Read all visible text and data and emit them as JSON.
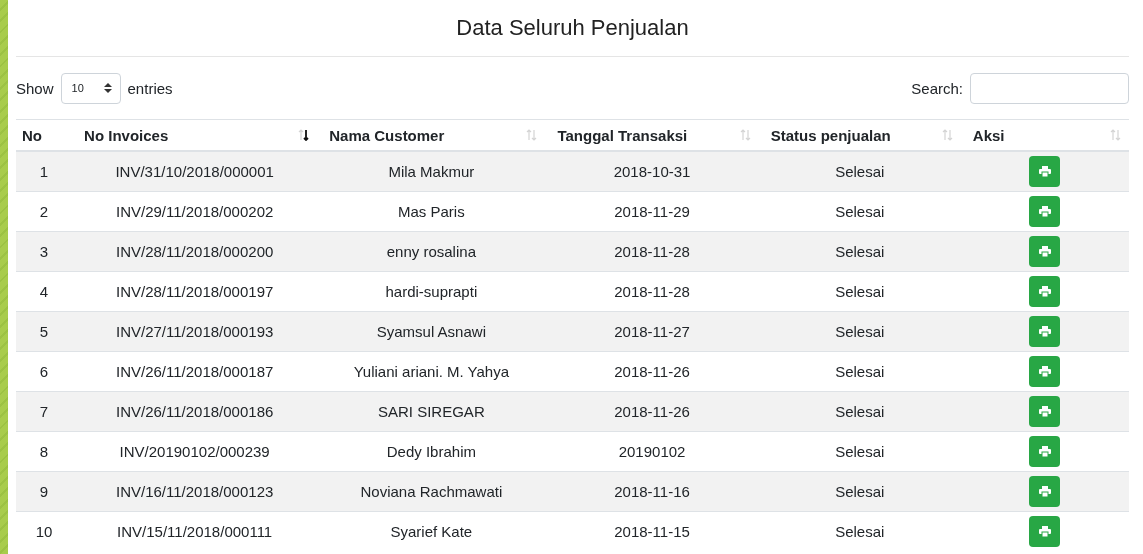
{
  "title": "Data Seluruh Penjualan",
  "length_control": {
    "label_before": "Show",
    "value": "10",
    "label_after": "entries"
  },
  "search": {
    "label": "Search:"
  },
  "table": {
    "columns": [
      {
        "label": "No",
        "sortable": false
      },
      {
        "label": "No Invoices",
        "sortable": true,
        "sorted": true
      },
      {
        "label": "Nama Customer",
        "sortable": true,
        "sorted": false
      },
      {
        "label": "Tanggal Transaksi",
        "sortable": true,
        "sorted": false
      },
      {
        "label": "Status penjualan",
        "sortable": true,
        "sorted": false
      },
      {
        "label": "Aksi",
        "sortable": true,
        "sorted": false
      }
    ],
    "rows": [
      [
        "1",
        "INV/31/10/2018/000001",
        "Mila Makmur",
        "2018-10-31",
        "Selesai"
      ],
      [
        "2",
        "INV/29/11/2018/000202",
        "Mas Paris",
        "2018-11-29",
        "Selesai"
      ],
      [
        "3",
        "INV/28/11/2018/000200",
        "enny rosalina",
        "2018-11-28",
        "Selesai"
      ],
      [
        "4",
        "INV/28/11/2018/000197",
        "hardi-suprapti",
        "2018-11-28",
        "Selesai"
      ],
      [
        "5",
        "INV/27/11/2018/000193",
        "Syamsul Asnawi",
        "2018-11-27",
        "Selesai"
      ],
      [
        "6",
        "INV/26/11/2018/000187",
        "Yuliani ariani. M. Yahya",
        "2018-11-26",
        "Selesai"
      ],
      [
        "7",
        "INV/26/11/2018/000186",
        "SARI SIREGAR",
        "2018-11-26",
        "Selesai"
      ],
      [
        "8",
        "INV/20190102/000239",
        "Dedy Ibrahim",
        "20190102",
        "Selesai"
      ],
      [
        "9",
        "INV/16/11/2018/000123",
        "Noviana Rachmawati",
        "2018-11-16",
        "Selesai"
      ],
      [
        "10",
        "INV/15/11/2018/000111",
        "Syarief Kate",
        "2018-11-15",
        "Selesai"
      ]
    ]
  }
}
